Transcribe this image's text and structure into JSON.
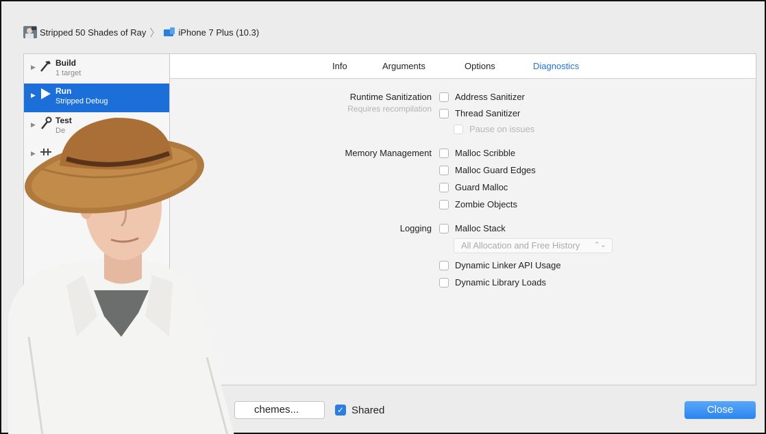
{
  "breadcrumb": {
    "scheme_name": "Stripped 50 Shades of Ray",
    "separator": "〉",
    "device_name": "iPhone 7 Plus (10.3)"
  },
  "sidebar": {
    "items": [
      {
        "title": "Build",
        "subtitle": "1 target",
        "icon": "hammer-icon"
      },
      {
        "title": "Run",
        "subtitle": "Stripped Debug",
        "icon": "play-icon",
        "selected": true
      },
      {
        "title": "Test",
        "subtitle": "De",
        "icon": "wrench-icon"
      },
      {
        "title": "",
        "subtitle": "",
        "icon": "profile-icon"
      },
      {
        "title": "",
        "subtitle": "",
        "icon": "analyze-icon"
      }
    ]
  },
  "tabs": [
    {
      "label": "Info"
    },
    {
      "label": "Arguments"
    },
    {
      "label": "Options"
    },
    {
      "label": "Diagnostics",
      "active": true
    }
  ],
  "diagnostics": {
    "runtime": {
      "label": "Runtime Sanitization",
      "note": "Requires recompilation",
      "options": [
        "Address Sanitizer",
        "Thread Sanitizer",
        "Pause on issues"
      ]
    },
    "memory": {
      "label": "Memory Management",
      "options": [
        "Malloc Scribble",
        "Malloc Guard Edges",
        "Guard Malloc",
        "Zombie Objects"
      ]
    },
    "logging": {
      "label": "Logging",
      "malloc_stack": "Malloc Stack",
      "popup_value": "All Allocation and Free History",
      "options": [
        "Dynamic Linker API Usage",
        "Dynamic Library Loads"
      ]
    }
  },
  "footer": {
    "manage_label": "chemes...",
    "shared_label": "Shared",
    "shared_checked": true,
    "close_label": "Close"
  },
  "colors": {
    "accent": "#1f74d6",
    "selection": "#1c6fd9",
    "close_button": "#2a85ef"
  }
}
